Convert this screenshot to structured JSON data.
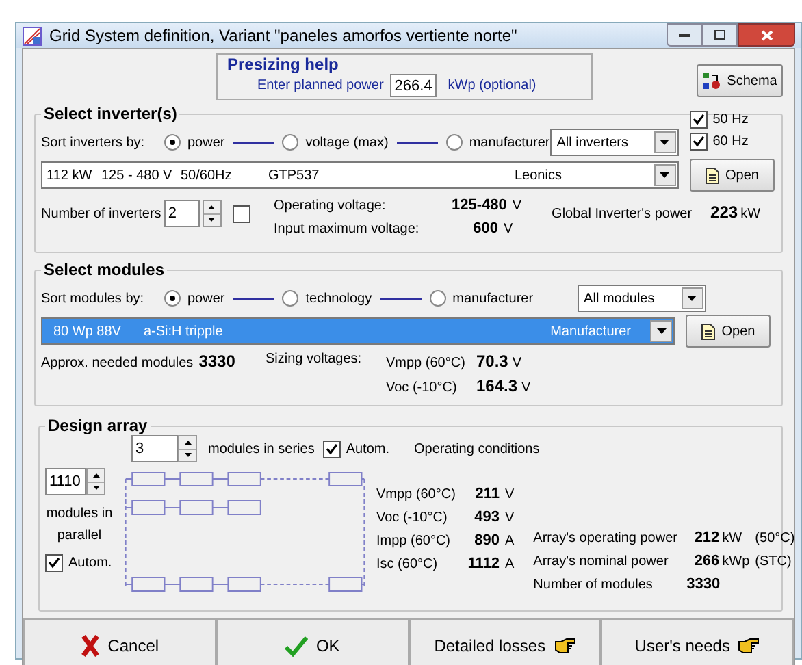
{
  "window": {
    "title": "Grid System definition, Variant  \"paneles amorfos vertiente norte\""
  },
  "presizing": {
    "title": "Presizing help",
    "label": "Enter planned power",
    "value": "266.4",
    "unit": "kWp (optional)"
  },
  "schema_button": "Schema",
  "inverters": {
    "title": "Select inverter(s)",
    "frequencies": [
      {
        "label": "50 Hz",
        "checked": true
      },
      {
        "label": "60 Hz",
        "checked": true
      }
    ],
    "sort_label": "Sort inverters by:",
    "sort_options": [
      {
        "label": "power",
        "selected": true
      },
      {
        "label": "voltage (max)",
        "selected": false
      },
      {
        "label": "manufacturer",
        "selected": false
      }
    ],
    "filter": "All inverters",
    "selection": {
      "power": "112 kW",
      "voltage": "125 - 480 V",
      "frequency": "50/60Hz",
      "model": "GTP537",
      "manufacturer": "Leonics",
      "highlighted": false
    },
    "open_button": "Open",
    "count_label": "Number of inverters",
    "count": "2",
    "extra_checked": false,
    "specs": [
      {
        "label": "Operating voltage:",
        "value": "125-480",
        "unit": "V"
      },
      {
        "label": "Input maximum  voltage:",
        "value": "600",
        "unit": "V"
      }
    ],
    "global_label": "Global Inverter's power",
    "global_value": "223",
    "global_unit": "kW"
  },
  "modules": {
    "title": "Select modules",
    "sort_label": "Sort modules by:",
    "sort_options": [
      {
        "label": "power",
        "selected": true
      },
      {
        "label": "technology",
        "selected": false
      },
      {
        "label": "manufacturer",
        "selected": false
      }
    ],
    "filter": "All modules",
    "selection": {
      "power": "80 Wp 88V",
      "technology": "a-Si:H tripple",
      "manufacturer": "Manufacturer",
      "highlighted": true
    },
    "open_button": "Open",
    "approx_label": "Approx. needed modules",
    "approx_value": "3330",
    "sizing_label": "Sizing voltages:",
    "sizing": [
      {
        "label": "Vmpp (60°C)",
        "value": "70.3",
        "unit": "V"
      },
      {
        "label": "Voc  (-10°C)",
        "value": "164.3",
        "unit": "V"
      }
    ]
  },
  "design": {
    "title": "Design array",
    "series_value": "3",
    "series_label": "modules in series",
    "series_autom": {
      "label": "Autom.",
      "checked": true
    },
    "operating_title": "Operating conditions",
    "parallel_value": "1110",
    "parallel_label": "modules in parallel",
    "parallel_autom": {
      "label": "Autom.",
      "checked": true
    },
    "conditions": [
      {
        "label": "Vmpp (60°C)",
        "value": "211",
        "unit": "V"
      },
      {
        "label": "Voc  (-10°C)",
        "value": "493",
        "unit": "V"
      },
      {
        "label": "Impp  (60°C)",
        "value": "890",
        "unit": "A"
      },
      {
        "label": "Isc  (60°C)",
        "value": "1112",
        "unit": "A"
      }
    ],
    "results": [
      {
        "label": "Array's operating power",
        "value": "212",
        "unit": "kW",
        "note": "(50°C)"
      },
      {
        "label": "Array's nominal power",
        "value": "266",
        "unit": "kWp",
        "note": "(STC)"
      },
      {
        "label": "Number of modules",
        "value": "3330"
      }
    ]
  },
  "buttons": [
    {
      "label": "Cancel",
      "kind": "cancel"
    },
    {
      "label": "OK",
      "kind": "ok"
    },
    {
      "label": "Detailed losses",
      "kind": "hand"
    },
    {
      "label": "User's needs",
      "kind": "hand"
    }
  ]
}
